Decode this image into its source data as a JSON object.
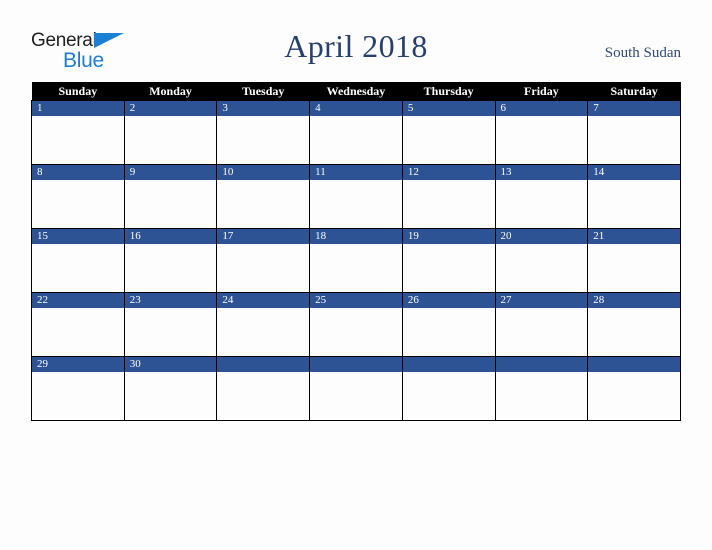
{
  "brand": {
    "name_part1": "General",
    "name_part2": "Blue",
    "triangle_icon": "triangle-icon",
    "color_dark": "#231f20",
    "color_blue": "#1b7fd4"
  },
  "header": {
    "title": "April 2018",
    "region": "South Sudan",
    "title_color": "#27416d",
    "region_color": "#2e4a77"
  },
  "calendar": {
    "month": "April",
    "year": "2018",
    "weekday_headers": [
      "Sunday",
      "Monday",
      "Tuesday",
      "Wednesday",
      "Thursday",
      "Friday",
      "Saturday"
    ],
    "header_bg": "#000000",
    "header_text_color": "#ffffff",
    "daynum_bg": "#2e5395",
    "daynum_text_color": "#ffffff",
    "cell_bg": "#fdfdfd",
    "grid_line_color": "#000000",
    "weeks": [
      {
        "days": [
          "1",
          "2",
          "3",
          "4",
          "5",
          "6",
          "7"
        ]
      },
      {
        "days": [
          "8",
          "9",
          "10",
          "11",
          "12",
          "13",
          "14"
        ]
      },
      {
        "days": [
          "15",
          "16",
          "17",
          "18",
          "19",
          "20",
          "21"
        ]
      },
      {
        "days": [
          "22",
          "23",
          "24",
          "25",
          "26",
          "27",
          "28"
        ]
      },
      {
        "days": [
          "29",
          "30",
          "",
          "",
          "",
          "",
          ""
        ]
      }
    ]
  },
  "page": {
    "background": "#fdfdfd"
  }
}
